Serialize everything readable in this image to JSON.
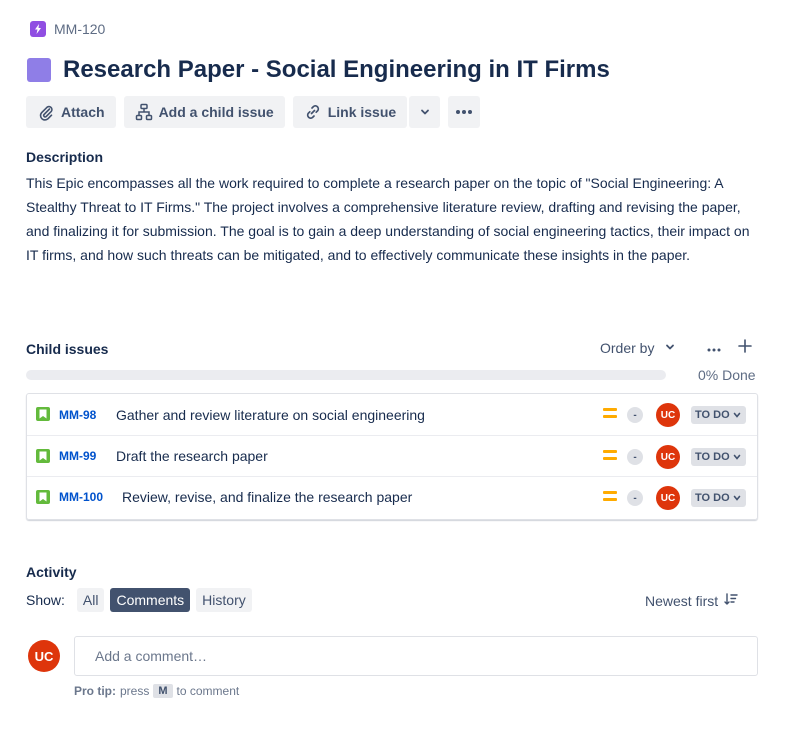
{
  "issue": {
    "key": "MM-120",
    "title": "Research Paper - Social Engineering in IT Firms",
    "type_icon": "lightning-icon",
    "epic_color": "#8f7ee7"
  },
  "toolbar": {
    "attach_label": "Attach",
    "add_child_label": "Add a child issue",
    "link_label": "Link issue"
  },
  "description": {
    "heading": "Description",
    "body": "This Epic encompasses all the work required to complete a research paper on the topic of \"Social Engineering: A Stealthy Threat to IT Firms.\" The project involves a comprehensive literature review, drafting and revising the paper, and finalizing it for submission. The goal is to gain a deep understanding of social engineering tactics, their impact on IT firms, and how such threats can be mitigated, and to effectively communicate these insights in the paper."
  },
  "child_issues": {
    "heading": "Child issues",
    "order_by_label": "Order by",
    "progress_fraction": 0,
    "progress_label": "0% Done",
    "items": [
      {
        "key": "MM-98",
        "summary": "Gather and review literature on social engineering",
        "priority": "medium",
        "estimate": "-",
        "assignee_initials": "UC",
        "status": "TO DO"
      },
      {
        "key": "MM-99",
        "summary": "Draft the research paper",
        "priority": "medium",
        "estimate": "-",
        "assignee_initials": "UC",
        "status": "TO DO"
      },
      {
        "key": "MM-100",
        "summary": "Review, revise, and finalize the research paper",
        "priority": "medium",
        "estimate": "-",
        "assignee_initials": "UC",
        "status": "TO DO"
      }
    ]
  },
  "activity": {
    "heading": "Activity",
    "show_label": "Show:",
    "filters": [
      "All",
      "Comments",
      "History"
    ],
    "active_filter": "Comments",
    "sort_label": "Newest first",
    "user_initials": "UC",
    "comment_placeholder": "Add a comment…",
    "protip_label": "Pro tip:",
    "protip_press": "press",
    "protip_key": "M",
    "protip_suffix": "to comment"
  },
  "colors": {
    "accent": "#0052cc",
    "avatar": "#de350b",
    "story": "#63ba3c",
    "priority_medium": "#ffab00",
    "active_filter_bg": "#42526e"
  }
}
